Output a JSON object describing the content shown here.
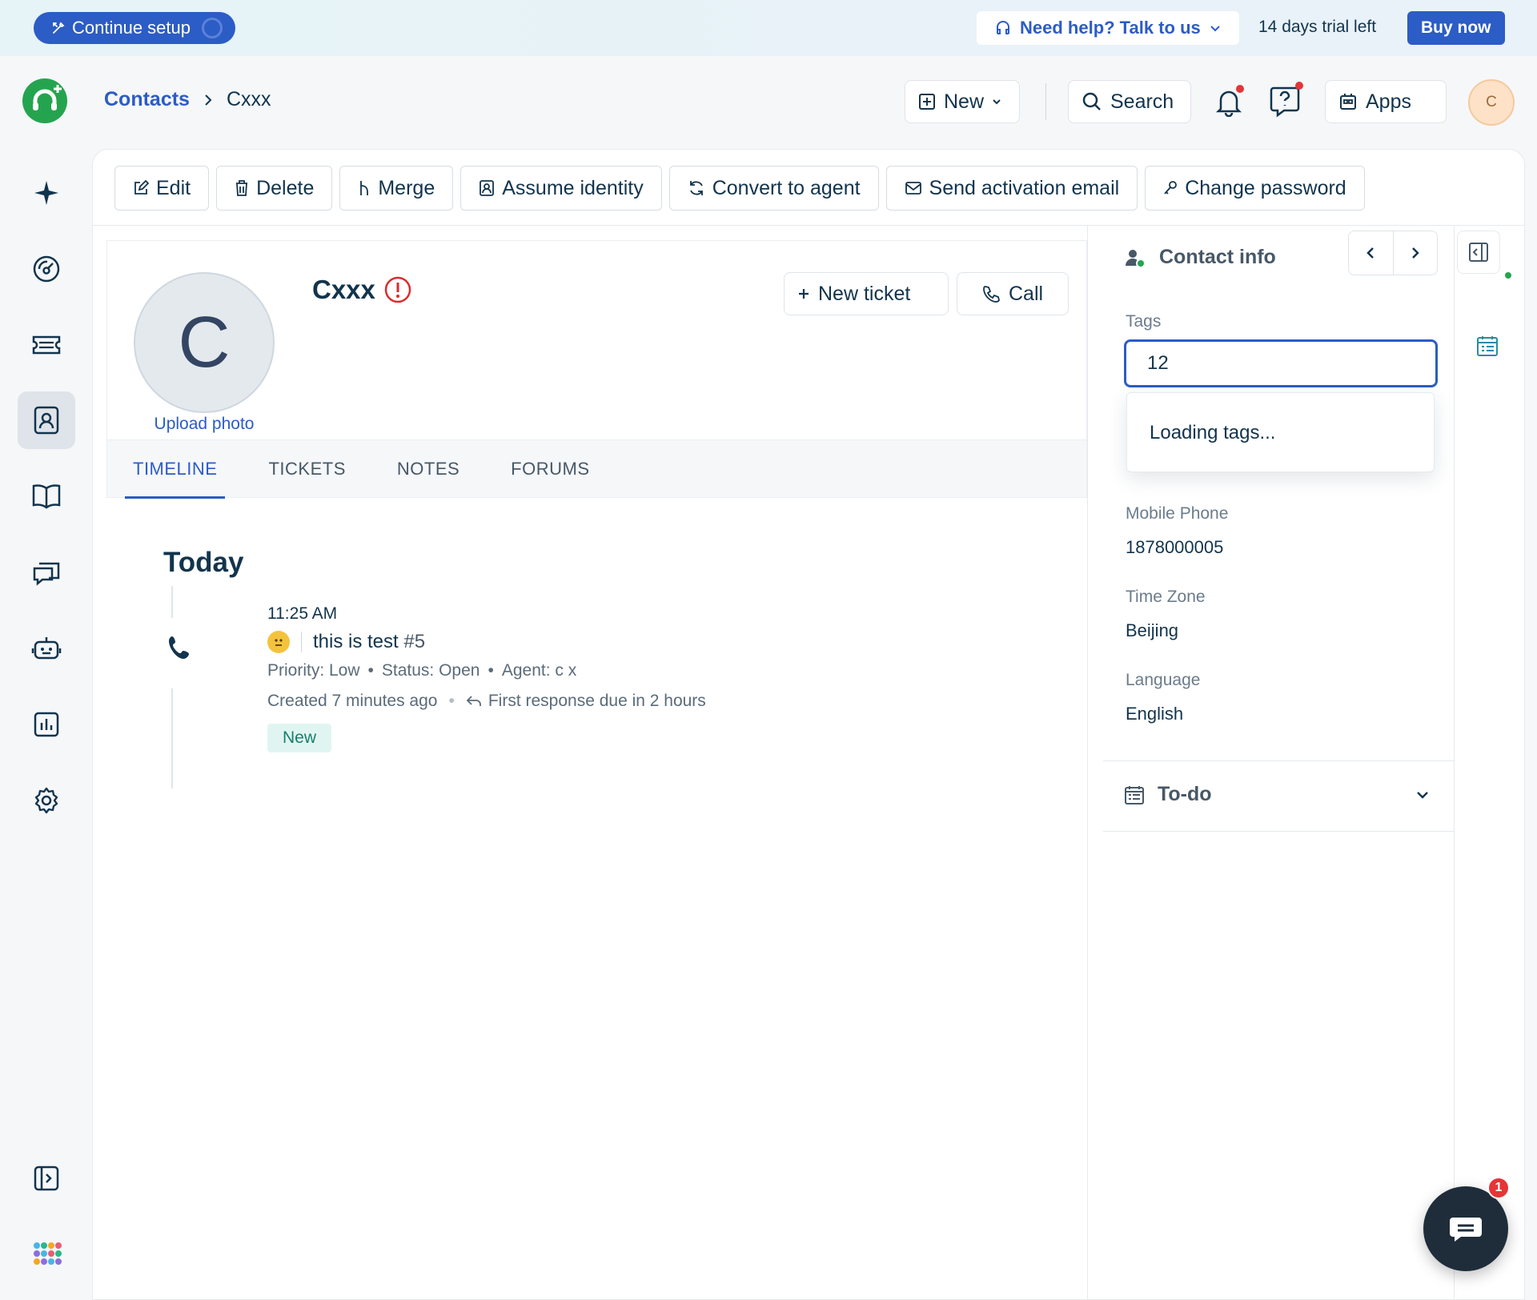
{
  "banner": {
    "continue_setup": "Continue setup",
    "need_help": "Need help? Talk to us",
    "trial": "14 days trial left",
    "buy_now": "Buy now"
  },
  "header": {
    "breadcrumb": {
      "root": "Contacts",
      "current": "Cxxx"
    },
    "new_label": "New",
    "search_label": "Search",
    "apps_label": "Apps",
    "avatar_initial": "C"
  },
  "toolbar": {
    "edit": "Edit",
    "delete": "Delete",
    "merge": "Merge",
    "assume_identity": "Assume identity",
    "convert_to_agent": "Convert to agent",
    "send_activation_email": "Send activation email",
    "change_password": "Change password"
  },
  "contact": {
    "initial": "C",
    "name": "Cxxx",
    "upload_photo": "Upload photo",
    "new_ticket": "New ticket",
    "call": "Call"
  },
  "tabs": [
    "TIMELINE",
    "TICKETS",
    "NOTES",
    "FORUMS"
  ],
  "timeline": {
    "day": "Today",
    "time": "11:25 AM",
    "subject": "this is test",
    "ticket_no": "#5",
    "priority": "Priority: Low",
    "status": "Status: Open",
    "agent": "Agent: c x",
    "created": "Created 7 minutes ago",
    "first_response": "First response due in 2 hours",
    "badge": "New"
  },
  "contact_info": {
    "title": "Contact info",
    "tags_label": "Tags",
    "tags_value": "12",
    "dropdown_text": "Loading tags...",
    "mobile_label": "Mobile Phone",
    "mobile_value": "1878000005",
    "tz_label": "Time Zone",
    "tz_value": "Beijing",
    "lang_label": "Language",
    "lang_value": "English",
    "todo_label": "To-do"
  },
  "chat": {
    "badge_count": "1"
  },
  "colors": {
    "primary": "#2c5cc5",
    "brand_green": "#25a44f",
    "text": "#12344d",
    "notify_red": "#e43538",
    "chat_dark": "#1f2d3a"
  }
}
